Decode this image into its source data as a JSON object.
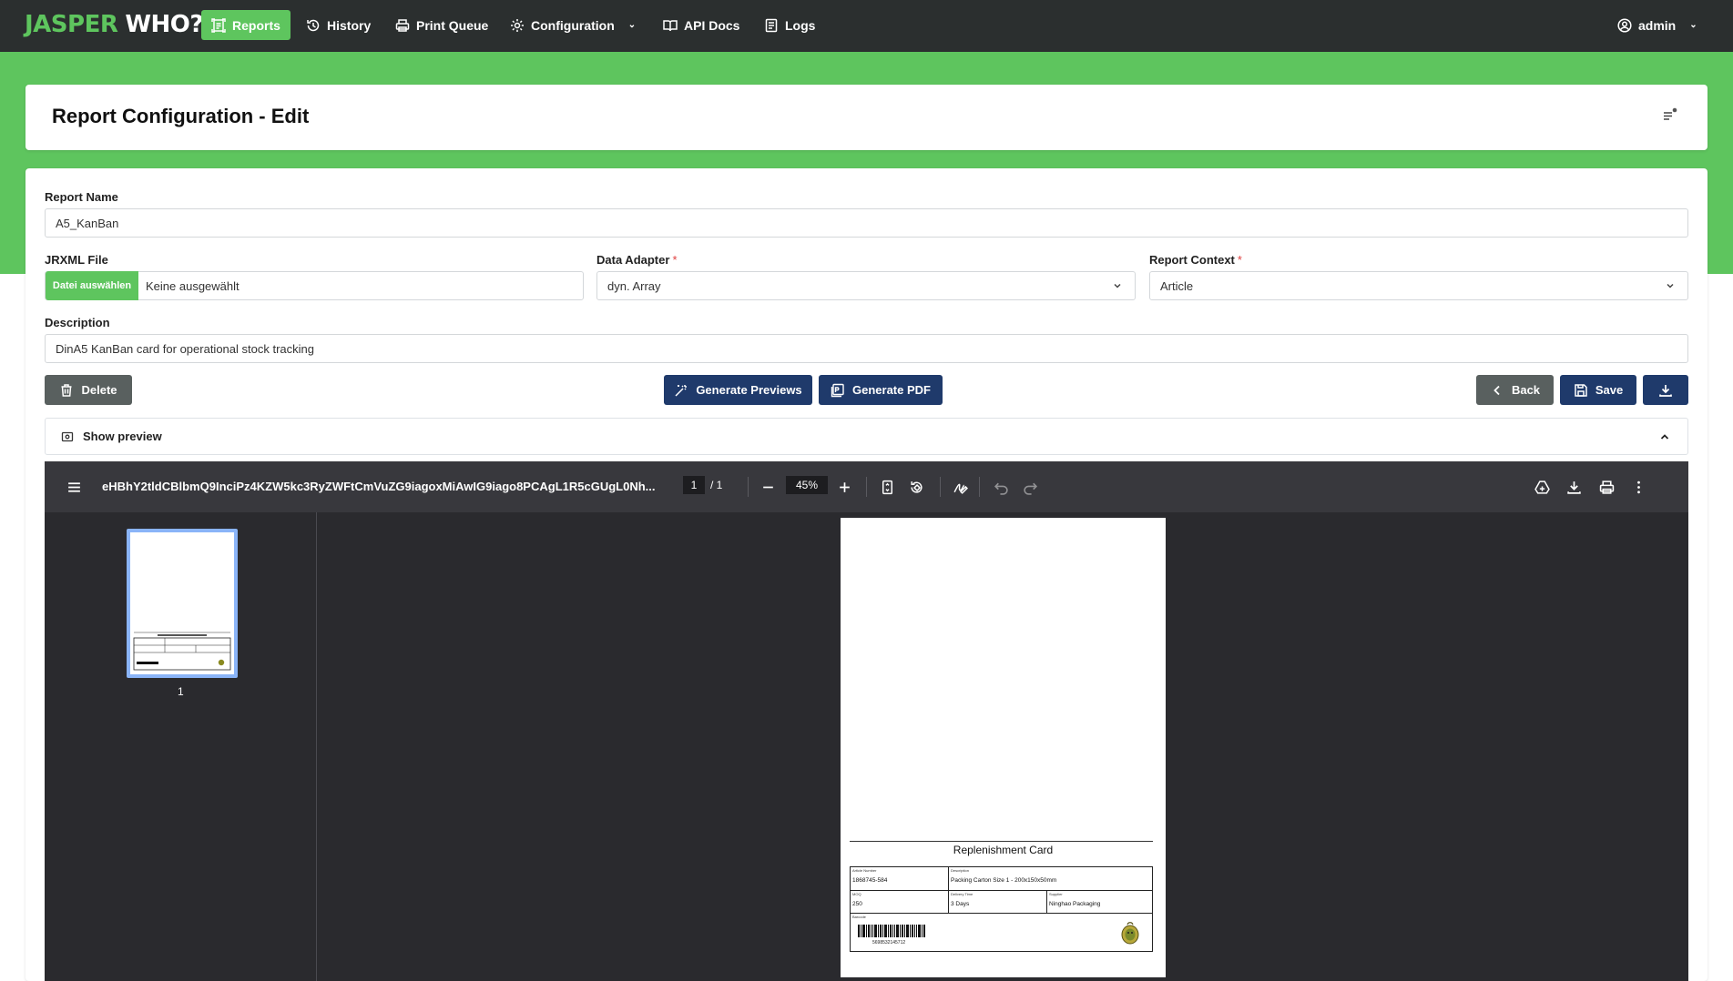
{
  "logo": {
    "part1": "JASPER",
    "part2": "WHO?"
  },
  "nav": {
    "reports": "Reports",
    "history": "History",
    "print_queue": "Print Queue",
    "configuration": "Configuration",
    "api_docs": "API Docs",
    "logs": "Logs",
    "user": "admin"
  },
  "page": {
    "title": "Report Configuration - Edit"
  },
  "form": {
    "report_name_label": "Report Name",
    "report_name_value": "A5_KanBan",
    "jrxml_label": "JRXML File",
    "jrxml_button": "Datei auswählen",
    "jrxml_value": "Keine ausgewählt",
    "adapter_label": "Data Adapter",
    "adapter_value": "dyn. Array",
    "context_label": "Report Context",
    "context_value": "Article",
    "required_mark": "*",
    "description_label": "Description",
    "description_value": "DinA5 KanBan card for operational stock tracking"
  },
  "actions": {
    "delete": "Delete",
    "generate_previews": "Generate Previews",
    "generate_pdf": "Generate PDF",
    "back": "Back",
    "save": "Save"
  },
  "preview": {
    "toggle_label": "Show preview"
  },
  "viewer": {
    "filename": "eHBhY2tldCBlbmQ9InciPz4KZW5kc3RyZWFtCmVuZG9iagoxMiAwIG9iago8PCAgL1R5cGUgL0Nh...",
    "current_page": "1",
    "total_pages": "1",
    "zoom": "45%",
    "thumb_label": "1"
  },
  "pdf_card": {
    "title": "Replenishment Card",
    "article_number_caption": "Article Number",
    "article_number": "1868745-584",
    "description_caption": "Description",
    "description": "Packing Carton Size 1 - 200x150x50mm",
    "moq_caption": "MOQ",
    "moq": "250",
    "delivery_caption": "Delivery Time",
    "delivery": "3 Days",
    "supplier_caption": "Supplier",
    "supplier": "Ninghao Packaging",
    "barcode_caption": "Barcode",
    "barcode_number": "5698532145712"
  },
  "colors": {
    "brand_green": "#5ec55e",
    "navbar": "#2b2f2f",
    "navy": "#1f3a6b",
    "grey_button": "#59605f"
  }
}
